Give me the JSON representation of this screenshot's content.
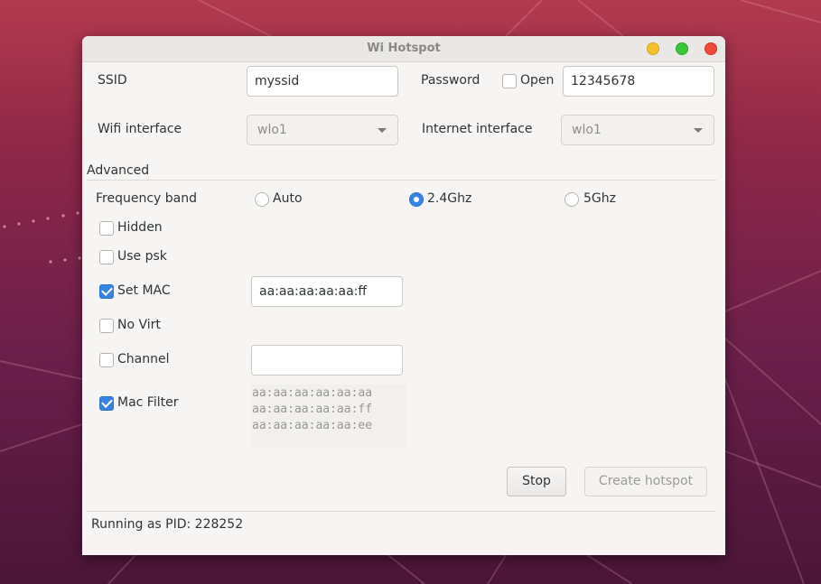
{
  "window": {
    "title": "Wi Hotspot"
  },
  "form": {
    "ssid_label": "SSID",
    "ssid_value": "myssid",
    "password_label": "Password",
    "open_label": "Open",
    "open_checked": false,
    "password_value": "12345678",
    "wifi_interface_label": "Wifi interface",
    "wifi_interface_value": "wlo1",
    "internet_interface_label": "Internet interface",
    "internet_interface_value": "wlo1"
  },
  "advanced": {
    "section_label": "Advanced",
    "frequency_label": "Frequency band",
    "frequency_options": [
      {
        "label": "Auto",
        "selected": false
      },
      {
        "label": "2.4Ghz",
        "selected": true
      },
      {
        "label": "5Ghz",
        "selected": false
      }
    ],
    "options": [
      {
        "label": "Hidden",
        "checked": false
      },
      {
        "label": "Use psk",
        "checked": false
      },
      {
        "label": "Set MAC",
        "checked": true
      },
      {
        "label": "No Virt",
        "checked": false
      },
      {
        "label": "Channel",
        "checked": false
      },
      {
        "label": "Mac Filter",
        "checked": true
      }
    ],
    "mac_value": "aa:aa:aa:aa:aa:ff",
    "channel_value": "",
    "mac_filter_lines": [
      "aa:aa:aa:aa:aa:aa",
      "aa:aa:aa:aa:aa:ff",
      "aa:aa:aa:aa:aa:ee"
    ]
  },
  "actions": {
    "stop_label": "Stop",
    "create_label": "Create hotspot"
  },
  "status": {
    "text": "Running as PID: 228252"
  },
  "colors": {
    "accent": "#3584e4",
    "window_bg": "#f6f5f4"
  }
}
